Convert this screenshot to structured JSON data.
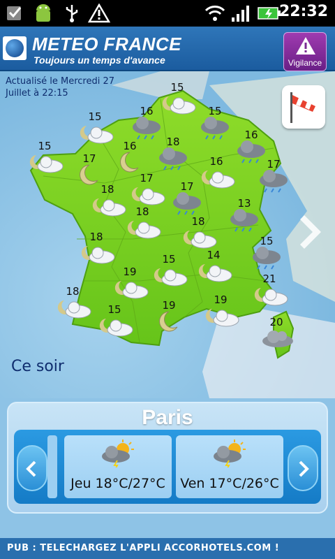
{
  "statusbar": {
    "time": "22:32"
  },
  "header": {
    "brand": "METEO FRANCE",
    "tagline": "Toujours un temps d'avance",
    "vigilance_label": "Vigilance"
  },
  "map": {
    "update_text": "Actualisé le Mercredi 27 Juillet à 22:15",
    "period_label": "Ce soir",
    "cities": [
      {
        "temp": "15",
        "icon": "night-cloud-icon"
      },
      {
        "temp": "16",
        "icon": "rain-cloud-icon"
      },
      {
        "temp": "15",
        "icon": "rain-cloud-icon"
      },
      {
        "temp": "15",
        "icon": "night-cloud-icon"
      },
      {
        "temp": "16",
        "icon": "rain-cloud-icon"
      },
      {
        "temp": "15",
        "icon": "night-cloud-icon"
      },
      {
        "temp": "17",
        "icon": "moon-icon"
      },
      {
        "temp": "16",
        "icon": "moon-icon"
      },
      {
        "temp": "18",
        "icon": "rain-cloud-icon"
      },
      {
        "temp": "16",
        "icon": "night-cloud-icon"
      },
      {
        "temp": "17",
        "icon": "rain-cloud-icon"
      },
      {
        "temp": "18",
        "icon": "night-cloud-icon"
      },
      {
        "temp": "17",
        "icon": "night-cloud-icon"
      },
      {
        "temp": "17",
        "icon": "rain-cloud-icon"
      },
      {
        "temp": "13",
        "icon": "rain-cloud-icon"
      },
      {
        "temp": "18",
        "icon": "night-cloud-icon"
      },
      {
        "temp": "18",
        "icon": "night-cloud-icon"
      },
      {
        "temp": "18",
        "icon": "night-cloud-icon"
      },
      {
        "temp": "15",
        "icon": "rain-cloud-icon"
      },
      {
        "temp": "14",
        "icon": "night-cloud-icon"
      },
      {
        "temp": "19",
        "icon": "night-cloud-icon"
      },
      {
        "temp": "15",
        "icon": "night-cloud-icon"
      },
      {
        "temp": "21",
        "icon": "night-cloud-icon"
      },
      {
        "temp": "18",
        "icon": "night-cloud-icon"
      },
      {
        "temp": "15",
        "icon": "night-cloud-icon"
      },
      {
        "temp": "19",
        "icon": "moon-icon"
      },
      {
        "temp": "19",
        "icon": "night-cloud-icon"
      },
      {
        "temp": "20",
        "icon": "cloud-icon"
      }
    ]
  },
  "panel": {
    "city": "Paris",
    "days": [
      {
        "label": "Jeu 18°C/27°C",
        "icon": "sun-storm-cloud-icon"
      },
      {
        "label": "Ven 17°C/26°C",
        "icon": "sun-storm-cloud-icon"
      }
    ]
  },
  "ad": {
    "text": "PUB : TELECHARGEZ L'APPLI ACCORHOTELS.COM !"
  },
  "colors": {
    "land": "#7ed321",
    "sea": "#8ec3e6",
    "header": "#1b5c9f",
    "vigilance": "#7a2a93"
  }
}
